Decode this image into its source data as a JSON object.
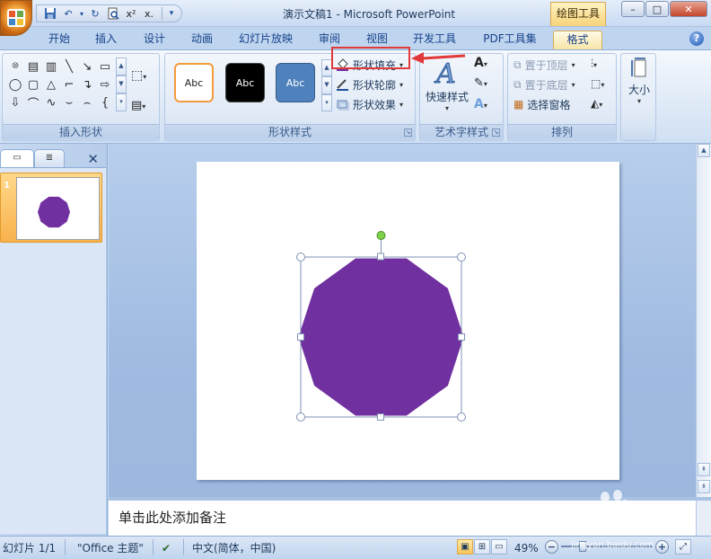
{
  "window": {
    "title": "演示文稿1 - Microsoft PowerPoint",
    "contextual_tab_group": "绘图工具",
    "controls": [
      "–",
      "□",
      "✕"
    ]
  },
  "quick_access": [
    "save",
    "undo",
    "redo",
    "print-preview",
    "x",
    "x"
  ],
  "ribbon_tabs": [
    "开始",
    "插入",
    "设计",
    "动画",
    "幻灯片放映",
    "审阅",
    "视图",
    "开发工具",
    "PDF工具集",
    "格式"
  ],
  "active_tab": "格式",
  "groups": {
    "insert_shapes": "插入形状",
    "shape_styles": "形状样式",
    "wordart_styles": "艺术字样式",
    "arrange": "排列",
    "size": "大小"
  },
  "style_gallery": [
    "Abc",
    "Abc",
    "Abc"
  ],
  "shape_style_commands": {
    "fill": "形状填充",
    "outline": "形状轮廓",
    "effects": "形状效果"
  },
  "wordart": {
    "quick_styles": "快速样式"
  },
  "arrange_commands": {
    "bring_front": "置于顶层",
    "send_back": "置于底层",
    "selection_pane": "选择窗格"
  },
  "size_label": "大小",
  "slides_pane": {
    "slide_number": "1"
  },
  "notes_placeholder": "单击此处添加备注",
  "status": {
    "slide_indicator": "幻灯片 1/1",
    "theme": "\"Office 主题\"",
    "language": "中文(简体，中国)",
    "zoom": "49%"
  },
  "shape": {
    "type": "decagon",
    "fill": "#7030a0"
  },
  "colors": {
    "highlight": "#e23a3a",
    "accent_tab": "#f7d47a"
  },
  "watermark": {
    "brand": "Baidu",
    "cn": "经验",
    "url": "jingyan.baidu.com"
  }
}
